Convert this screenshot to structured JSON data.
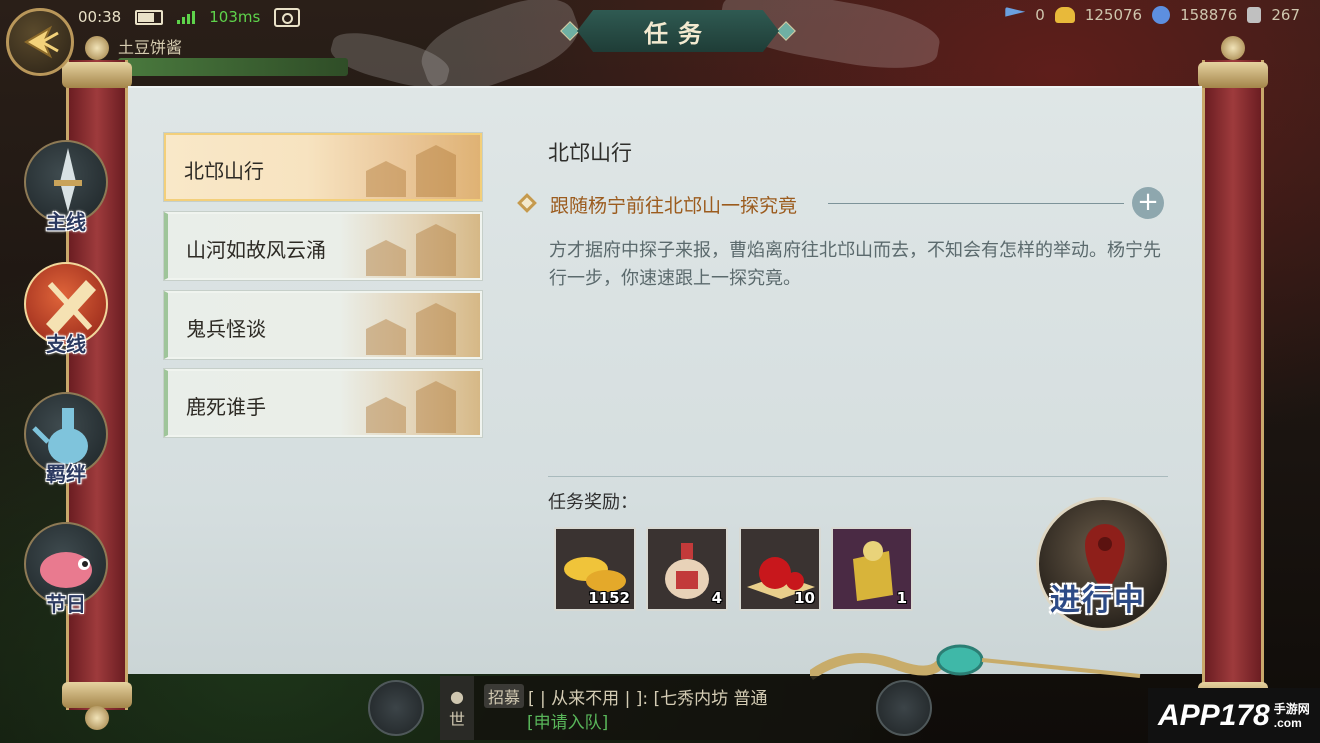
{
  "status": {
    "time": "00:38",
    "ping": "103ms",
    "player_name": "土豆饼酱"
  },
  "currencies": [
    {
      "icon": "flag-icon",
      "value": "0",
      "color": "#6aa0e0"
    },
    {
      "icon": "gold-ingot-icon",
      "value": "125076",
      "color": "#e8b93a"
    },
    {
      "icon": "silver-coin-icon",
      "value": "158876",
      "color": "#5d8fe0"
    },
    {
      "icon": "gem-icon",
      "value": "267",
      "color": "#c0c0c0"
    }
  ],
  "header": {
    "title": "任务"
  },
  "side_tabs": [
    {
      "label": "主线",
      "icon": "sword-icon",
      "active": false
    },
    {
      "label": "支线",
      "icon": "scroll-icon",
      "active": true
    },
    {
      "label": "羁绊",
      "icon": "teapot-icon",
      "active": false
    },
    {
      "label": "节日",
      "icon": "fish-lantern-icon",
      "active": false
    }
  ],
  "quests": [
    {
      "label": "北邙山行",
      "selected": true
    },
    {
      "label": "山河如故风云涌",
      "selected": false
    },
    {
      "label": "鬼兵怪谈",
      "selected": false
    },
    {
      "label": "鹿死谁手",
      "selected": false
    }
  ],
  "detail": {
    "title": "北邙山行",
    "objective": "跟随杨宁前往北邙山一探究竟",
    "description": "方才据府中探子来报，曹焰离府往北邙山而去，不知会有怎样的举动。杨宁先行一步，你速速跟上一探究竟。",
    "reward_label": "任务奖励：",
    "rewards": [
      {
        "icon": "gold-ingots-icon",
        "count": "1152"
      },
      {
        "icon": "pill-gourd-icon",
        "count": "4"
      },
      {
        "icon": "red-beads-icon",
        "count": "10"
      },
      {
        "icon": "token-charm-icon",
        "count": "1"
      }
    ],
    "status": "进行中"
  },
  "chat": {
    "channel": "招募",
    "message": "[ | 从来不用 | ]: [七秀内坊 普通",
    "link": "[申请入队]",
    "mic_label": "世"
  },
  "watermark": {
    "text": "APP178",
    "sub1": "手游网",
    "sub2": ".com"
  }
}
